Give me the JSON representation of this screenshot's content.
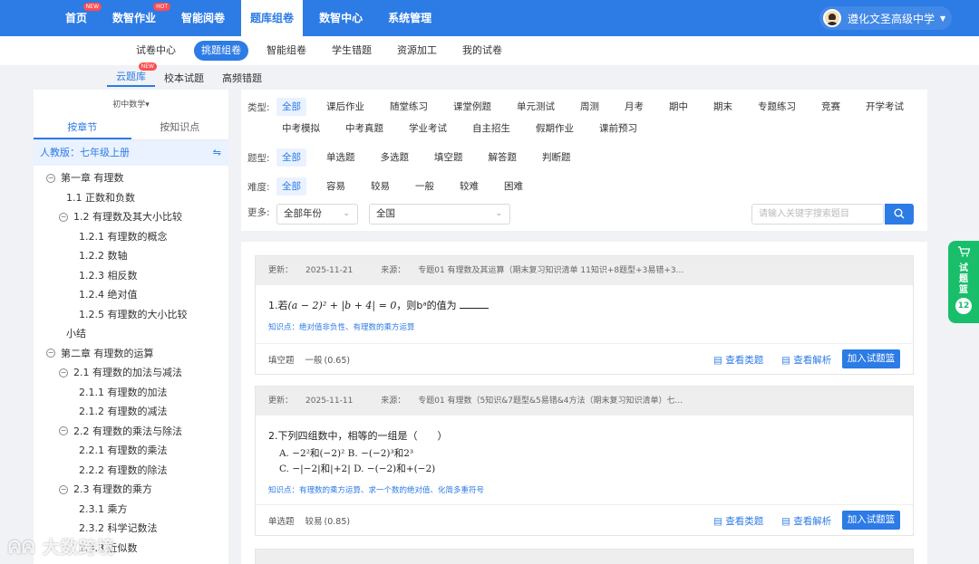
{
  "topnav": {
    "items": [
      {
        "label": "首页",
        "badge": "NEW"
      },
      {
        "label": "数智作业",
        "badge": "HOT"
      },
      {
        "label": "智能阅卷",
        "badge": ""
      },
      {
        "label": "题库组卷",
        "badge": ""
      },
      {
        "label": "数智中心",
        "badge": ""
      },
      {
        "label": "系统管理",
        "badge": ""
      }
    ],
    "active_index": 3,
    "user": "遵化文圣高级中学"
  },
  "subnav": {
    "items": [
      "试卷中心",
      "挑题组卷",
      "智能组卷",
      "学生错题",
      "资源加工",
      "我的试卷"
    ],
    "active_index": 1
  },
  "thirdnav": {
    "items": [
      "云题库",
      "校本试题",
      "高频错题"
    ],
    "badge": "NEW"
  },
  "sidebar": {
    "grade": "初中数学",
    "tabs": [
      "按章节",
      "按知识点"
    ],
    "edition": "人教版：七年级上册",
    "switch_icon": "swap-icon",
    "tree": [
      {
        "label": "第一章 有理数",
        "level": 0,
        "toggle": "−"
      },
      {
        "label": "1.1 正数和负数",
        "level": 1,
        "toggle": ""
      },
      {
        "label": "1.2 有理数及其大小比较",
        "level": 1,
        "toggle": "−"
      },
      {
        "label": "1.2.1 有理数的概念",
        "level": 2,
        "toggle": ""
      },
      {
        "label": "1.2.2 数轴",
        "level": 2,
        "toggle": ""
      },
      {
        "label": "1.2.3 相反数",
        "level": 2,
        "toggle": ""
      },
      {
        "label": "1.2.4 绝对值",
        "level": 2,
        "toggle": ""
      },
      {
        "label": "1.2.5 有理数的大小比较",
        "level": 2,
        "toggle": ""
      },
      {
        "label": "小结",
        "level": 1,
        "toggle": ""
      },
      {
        "label": "第二章 有理数的运算",
        "level": 0,
        "toggle": "−"
      },
      {
        "label": "2.1 有理数的加法与减法",
        "level": 1,
        "toggle": "−"
      },
      {
        "label": "2.1.1 有理数的加法",
        "level": 2,
        "toggle": ""
      },
      {
        "label": "2.1.2 有理数的减法",
        "level": 2,
        "toggle": ""
      },
      {
        "label": "2.2 有理数的乘法与除法",
        "level": 1,
        "toggle": "−"
      },
      {
        "label": "2.2.1 有理数的乘法",
        "level": 2,
        "toggle": ""
      },
      {
        "label": "2.2.2 有理数的除法",
        "level": 2,
        "toggle": ""
      },
      {
        "label": "2.3 有理数的乘方",
        "level": 1,
        "toggle": "−"
      },
      {
        "label": "2.3.1 乘方",
        "level": 2,
        "toggle": ""
      },
      {
        "label": "2.3.2 科学记数法",
        "level": 2,
        "toggle": ""
      },
      {
        "label": "2.3.3 近似数",
        "level": 2,
        "toggle": ""
      }
    ]
  },
  "filters": {
    "type": {
      "label": "类型:",
      "options": [
        "全部",
        "课后作业",
        "随堂练习",
        "课堂例题",
        "单元测试",
        "周测",
        "月考",
        "期中",
        "期末",
        "专题练习",
        "竞赛",
        "开学考试"
      ],
      "options2": [
        "中考模拟",
        "中考真题",
        "学业考试",
        "自主招生",
        "假期作业",
        "课前预习"
      ]
    },
    "qtype": {
      "label": "题型:",
      "options": [
        "全部",
        "单选题",
        "多选题",
        "填空题",
        "解答题",
        "判断题"
      ]
    },
    "difficulty": {
      "label": "难度:",
      "options": [
        "全部",
        "容易",
        "较易",
        "一般",
        "较难",
        "困难"
      ]
    },
    "more": {
      "label": "更多:",
      "grade_select": "全部年份",
      "region_select": "全国"
    },
    "search_placeholder": "请输入关键字搜索题目"
  },
  "questions": [
    {
      "update_label": "更新：",
      "date": "2025-11-21",
      "source_label": "来源：",
      "source": "专题01 有理数及其运算（期末复习知识清单 11知识+8题型+3易错+3...",
      "stem_prefix": "1.若",
      "stem_math": "(a − 2)² + |b + 4| = 0",
      "stem_suffix": "，则bᵃ的值为",
      "kp_label": "知识点：",
      "kp": "绝对值非负性、有理数的乘方运算",
      "qtype": "填空题",
      "difficulty": "一般",
      "score": "(0.65)"
    },
    {
      "update_label": "更新：",
      "date": "2025-11-11",
      "source_label": "来源：",
      "source": "专题01 有理数（5知识&7题型&5易错&4方法（期末复习知识清单）七...",
      "stem": "2.下列四组数中，相等的一组是（　　）",
      "optA": "A. −2²和(−2)²",
      "optB": "B. −(−2)³和2³",
      "optC": "C. −|−2|和|+2|",
      "optD": "D. −(−2)和+(−2)",
      "kp_label": "知识点：",
      "kp": "有理数的乘方运算、求一个数的绝对值、化简多重符号",
      "qtype": "单选题",
      "difficulty": "较易",
      "score": "(0.85)"
    }
  ],
  "actions": {
    "similar": "查看类题",
    "analysis": "查看解析",
    "add": "加入试题篮"
  },
  "basket": {
    "label": "试题篮",
    "count": "12"
  },
  "watermark": "大数跨境",
  "colors": {
    "primary": "#2d7be5",
    "basket": "#19be6b"
  }
}
